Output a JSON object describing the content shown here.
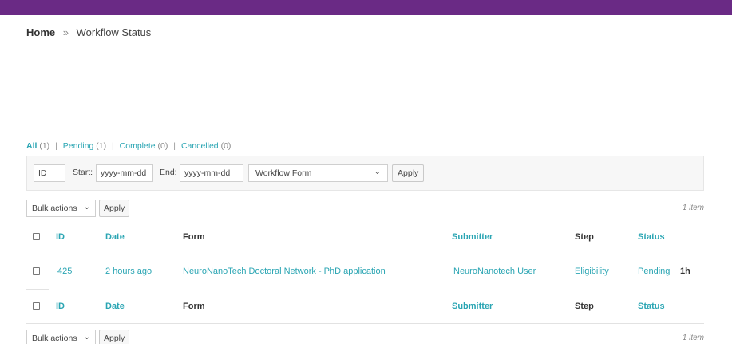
{
  "breadcrumb": {
    "home": "Home",
    "separator": "»",
    "current": "Workflow Status"
  },
  "filters": [
    {
      "label": "All",
      "count": "(1)"
    },
    {
      "label": "Pending",
      "count": "(1)"
    },
    {
      "label": "Complete",
      "count": "(0)"
    },
    {
      "label": "Cancelled",
      "count": "(0)"
    }
  ],
  "search": {
    "id_placeholder": "ID",
    "start_label": "Start:",
    "start_placeholder": "yyyy-mm-dd",
    "end_label": "End:",
    "end_placeholder": "yyyy-mm-dd",
    "form_select": "Workflow Form",
    "apply_label": "Apply"
  },
  "tablenav_top": {
    "bulk_label": "Bulk actions",
    "apply_label": "Apply",
    "items": "1 item"
  },
  "tablenav_bottom": {
    "bulk_label": "Bulk actions",
    "apply_label": "Apply",
    "items": "1 item"
  },
  "columns": {
    "id": "ID",
    "date": "Date",
    "form": "Form",
    "submitter": "Submitter",
    "step": "Step",
    "status": "Status"
  },
  "rows": [
    {
      "id": "425",
      "date": "2 hours ago",
      "form": "NeuroNanoTech Doctoral Network - PhD application",
      "submitter": "NeuroNanotech User",
      "step": "Eligibility",
      "status": "Pending",
      "duration": "1h"
    }
  ],
  "colors": {
    "top_bar": "#6a2a85",
    "link": "#2aa5b3"
  }
}
